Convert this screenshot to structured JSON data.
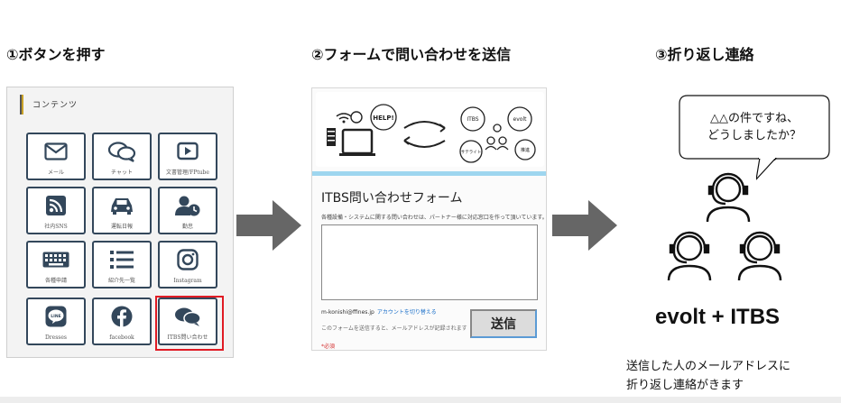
{
  "steps": [
    {
      "title": "①ボタンを押す"
    },
    {
      "title": "②フォームで問い合わせを送信"
    },
    {
      "title": "③折り返し連絡"
    }
  ],
  "contents_menu": {
    "header": "コンテンツ",
    "tiles": [
      {
        "label": "メール",
        "icon": "mail-icon"
      },
      {
        "label": "チャット",
        "icon": "chat-icon"
      },
      {
        "label": "文書管理/FPtube",
        "icon": "video-icon"
      },
      {
        "label": "社内SNS",
        "icon": "rss-icon"
      },
      {
        "label": "運転日報",
        "icon": "car-icon"
      },
      {
        "label": "勤怠",
        "icon": "user-clock-icon"
      },
      {
        "label": "各種申請",
        "icon": "keyboard-icon"
      },
      {
        "label": "紹介先一覧",
        "icon": "list-icon"
      },
      {
        "label": "Instagram",
        "icon": "instagram-icon"
      },
      {
        "label": "Dresses",
        "icon": "line-icon"
      },
      {
        "label": "facebook",
        "icon": "facebook-icon"
      },
      {
        "label": "ITBS問い合わせ",
        "icon": "chat-icon",
        "highlighted": true
      }
    ]
  },
  "form": {
    "illustration": {
      "help": "HELP!",
      "itbs": "ITBS",
      "evolt": "evolt",
      "support": "サテライト",
      "team": "推進"
    },
    "title": "ITBS問い合わせフォーム",
    "description": "各種設備・システムに関する問い合わせは、パートナー様に対応窓口を作って頂いています。",
    "email": "m-konishi@ffines.jp",
    "switch_account": "アカウントを切り替える",
    "note": "このフォームを送信すると、メールアドレスが記録されます",
    "required": "*必須",
    "send_label": "送信"
  },
  "reply": {
    "bubble_line1": "△△の件ですね、",
    "bubble_line2": "どうしましたか？",
    "brand": "evolt + ITBS",
    "note_line1": "送信した人のメールアドレスに",
    "note_line2": "折り返し連絡がきます"
  },
  "colors": {
    "tile_border": "#33475b",
    "highlight": "#e01b24",
    "arrow": "#666666",
    "form_stripe": "#9ed6ef",
    "link": "#1a6fc9"
  }
}
